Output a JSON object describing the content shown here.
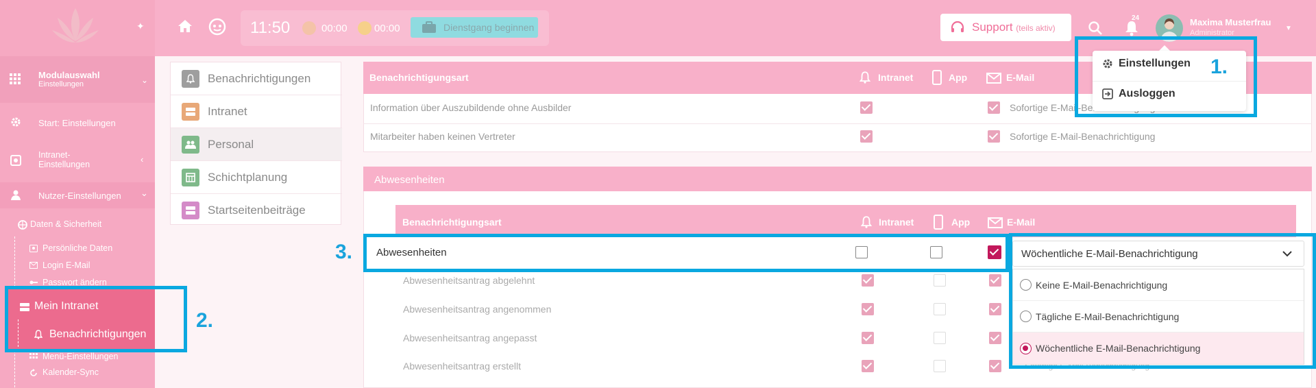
{
  "header": {
    "time": "11:50",
    "timer1": "00:00",
    "timer2": "00:00",
    "dienstgang_label": "Dienstgang beginnen",
    "support_label": "Support",
    "support_note": "(teils aktiv)",
    "notification_count": "24",
    "user_name": "Maxima Musterfrau",
    "user_role": "Administrator"
  },
  "user_menu": {
    "settings_label": "Einstellungen",
    "logout_label": "Ausloggen"
  },
  "sidebar": {
    "module_title": "Modulauswahl",
    "module_sub": "Einstellungen",
    "start_label": "Start: Einstellungen",
    "intranet_label_1": "Intranet-",
    "intranet_label_2": "Einstellungen",
    "nutzer_label": "Nutzer-Einstellungen",
    "daten_label": "Daten & Sicherheit",
    "persoenlich_label": "Persönliche Daten",
    "login_email_label": "Login E-Mail",
    "passwort_label": "Passwort ändern",
    "mein_intranet_label": "Mein Intranet",
    "benachrichtigungen_label": "Benachrichtigungen",
    "menu_label": "Menü-Einstellungen",
    "kalender_label": "Kalender-Sync"
  },
  "categories": [
    {
      "label": "Benachrichtigungen",
      "color": "#9e9e9e"
    },
    {
      "label": "Intranet",
      "color": "#e8a878"
    },
    {
      "label": "Personal",
      "color": "#7fb98a"
    },
    {
      "label": "Schichtplanung",
      "color": "#7fb98a"
    },
    {
      "label": "Startseitenbeiträge",
      "color": "#d48bc8"
    }
  ],
  "table1": {
    "col_type": "Benachrichtigungsart",
    "col_intranet": "Intranet",
    "col_app": "App",
    "col_email": "E-Mail",
    "rows": [
      {
        "label": "Information über Auszubildende ohne Ausbilder",
        "email": "Sofortige E-Mail-Benachrichtigung"
      },
      {
        "label": "Mitarbeiter haben keinen Vertreter",
        "email": "Sofortige E-Mail-Benachrichtigung"
      }
    ]
  },
  "section2": {
    "title": "Abwesenheiten",
    "col_type": "Benachrichtigungsart",
    "col_intranet": "Intranet",
    "col_app": "App",
    "col_email": "E-Mail",
    "group_row": "Abwesenheiten",
    "select_value": "Wöchentliche E-Mail-Benachrichtigung",
    "options": [
      "Keine E-Mail-Benachrichtigung",
      "Tägliche E-Mail-Benachrichtigung",
      "Wöchentliche E-Mail-Benachrichtigung"
    ],
    "rows": [
      "Abwesenheitsantrag abgelehnt",
      "Abwesenheitsantrag angenommen",
      "Abwesenheitsantrag angepasst",
      "Abwesenheitsantrag erstellt"
    ],
    "hidden_email_fragment": "Sofortige E-Mail-Benachrichtigung"
  },
  "annotations": {
    "step1": "1.",
    "step2": "2.",
    "step3": "3."
  },
  "colors": {
    "header_pink": "#f8b0c9",
    "sidebar_pink": "#f6a9c2",
    "highlight_blue": "#0aa8e0",
    "accent_magenta": "#c2185b"
  }
}
